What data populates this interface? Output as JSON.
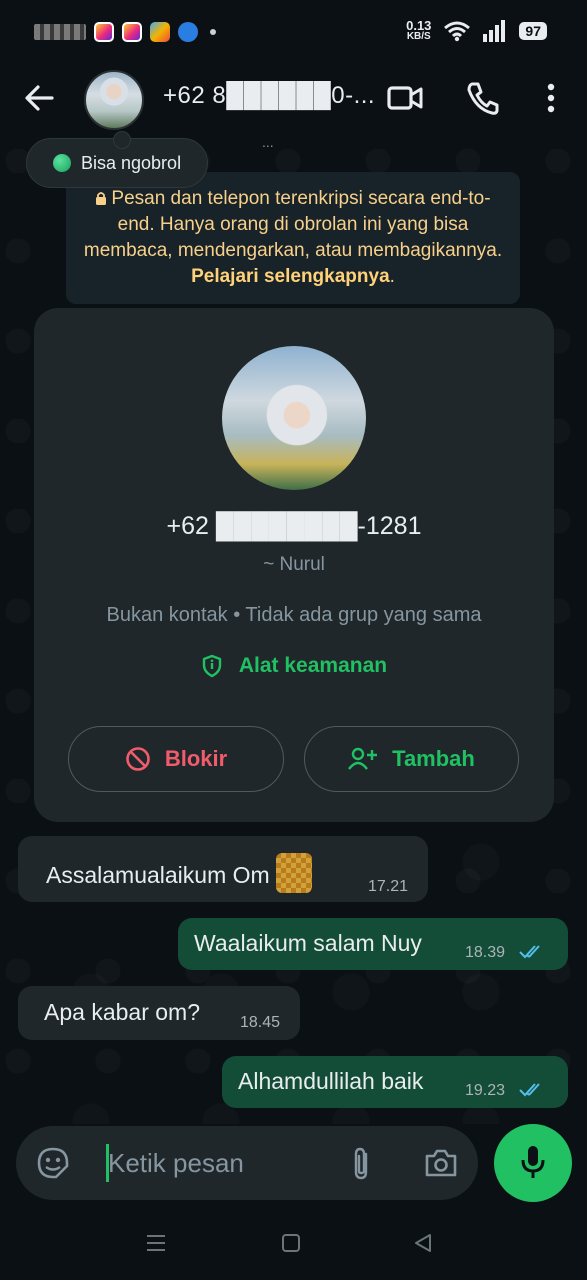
{
  "status_bar": {
    "net_speed_value": "0.13",
    "net_speed_unit": "KB/S",
    "battery": "97"
  },
  "header": {
    "title": "+62 8██████0-..."
  },
  "chat": {
    "time_peek": "...",
    "online_status": "Bisa ngobrol",
    "encryption_notice": "Pesan dan telepon terenkripsi secara end-to-end. Hanya orang di obrolan ini yang bisa membaca, mendengarkan, atau membagikannya.",
    "encryption_link": "Pelajari selengkapnya",
    "contact_card": {
      "phone": "+62 ████████-1281",
      "name": "~ Nurul",
      "meta": "Bukan kontak • Tidak ada grup yang sama",
      "safety_label": "Alat keamanan",
      "block_label": "Blokir",
      "add_label": "Tambah"
    },
    "messages": [
      {
        "direction": "in",
        "text": "Assalamualaikum Om",
        "time": "17.21"
      },
      {
        "direction": "out",
        "text": "Waalaikum salam Nuy",
        "time": "18.39",
        "read": true
      },
      {
        "direction": "in",
        "text": "Apa kabar om?",
        "time": "18.45"
      },
      {
        "direction": "out",
        "text": "Alhamdullilah baik",
        "time": "19.23",
        "read": true
      }
    ]
  },
  "composer": {
    "placeholder": "Ketik pesan"
  },
  "colors": {
    "background": "#0b1014",
    "accent_green": "#21c063",
    "outgoing_bubble": "#134d37",
    "incoming_bubble": "#1f272a",
    "danger_red": "#f15c6d",
    "notice_text": "#f7d08a"
  }
}
